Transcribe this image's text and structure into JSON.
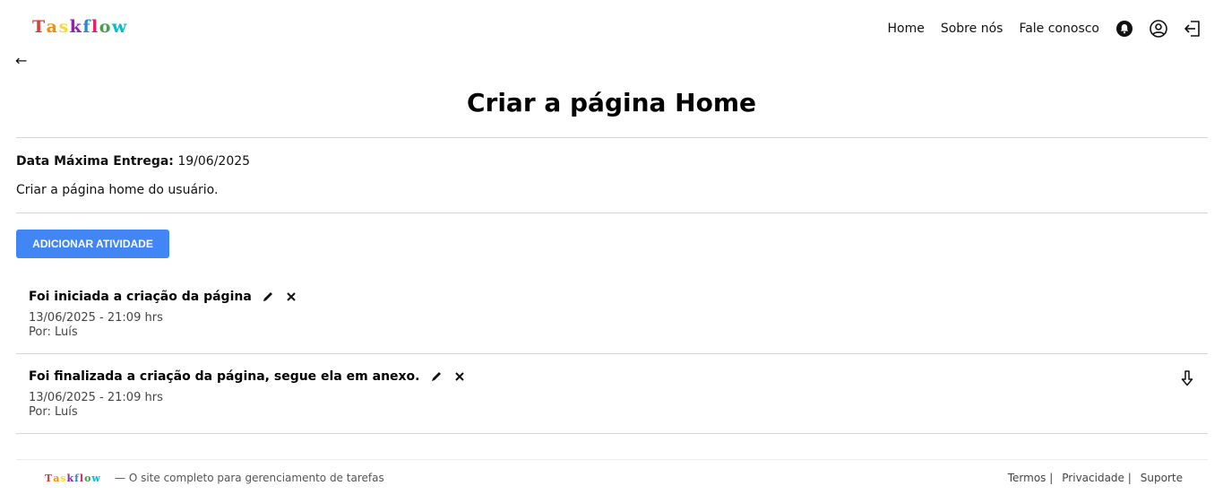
{
  "brand": {
    "name": "Taskflow",
    "letter_colors": [
      "#e53935",
      "#fb8c00",
      "#fdd835",
      "#8e24aa",
      "#1e88e5",
      "#e91e63",
      "#43a047",
      "#00bcd4"
    ]
  },
  "nav": {
    "links": [
      "Home",
      "Sobre nós",
      "Fale conosco"
    ],
    "icons": [
      "bell-icon",
      "user-circle-icon",
      "logout-icon"
    ]
  },
  "page": {
    "back": "←",
    "title": "Criar a página Home",
    "deadline_label": "Data Máxima Entrega:",
    "deadline_value": "19/06/2025",
    "description": "Criar a página home do usuário.",
    "add_button": "ADICIONAR ATIVIDADE"
  },
  "activities": [
    {
      "title": "Foi iniciada a criação da página",
      "datetime": "13/06/2025 - 21:09 hrs",
      "author": "Por: Luís",
      "has_attachment": false
    },
    {
      "title": "Foi finalizada a criação da página, segue ela em anexo.",
      "datetime": "13/06/2025 - 21:09 hrs",
      "author": "Por: Luís",
      "has_attachment": true
    }
  ],
  "footer": {
    "tagline": "— O site completo para gerenciamento de tarefas",
    "links": [
      "Termos |",
      "Privacidade |",
      "Suporte"
    ]
  },
  "colors": {
    "accent": "#4285f4",
    "divider": "#d6d6d6"
  }
}
